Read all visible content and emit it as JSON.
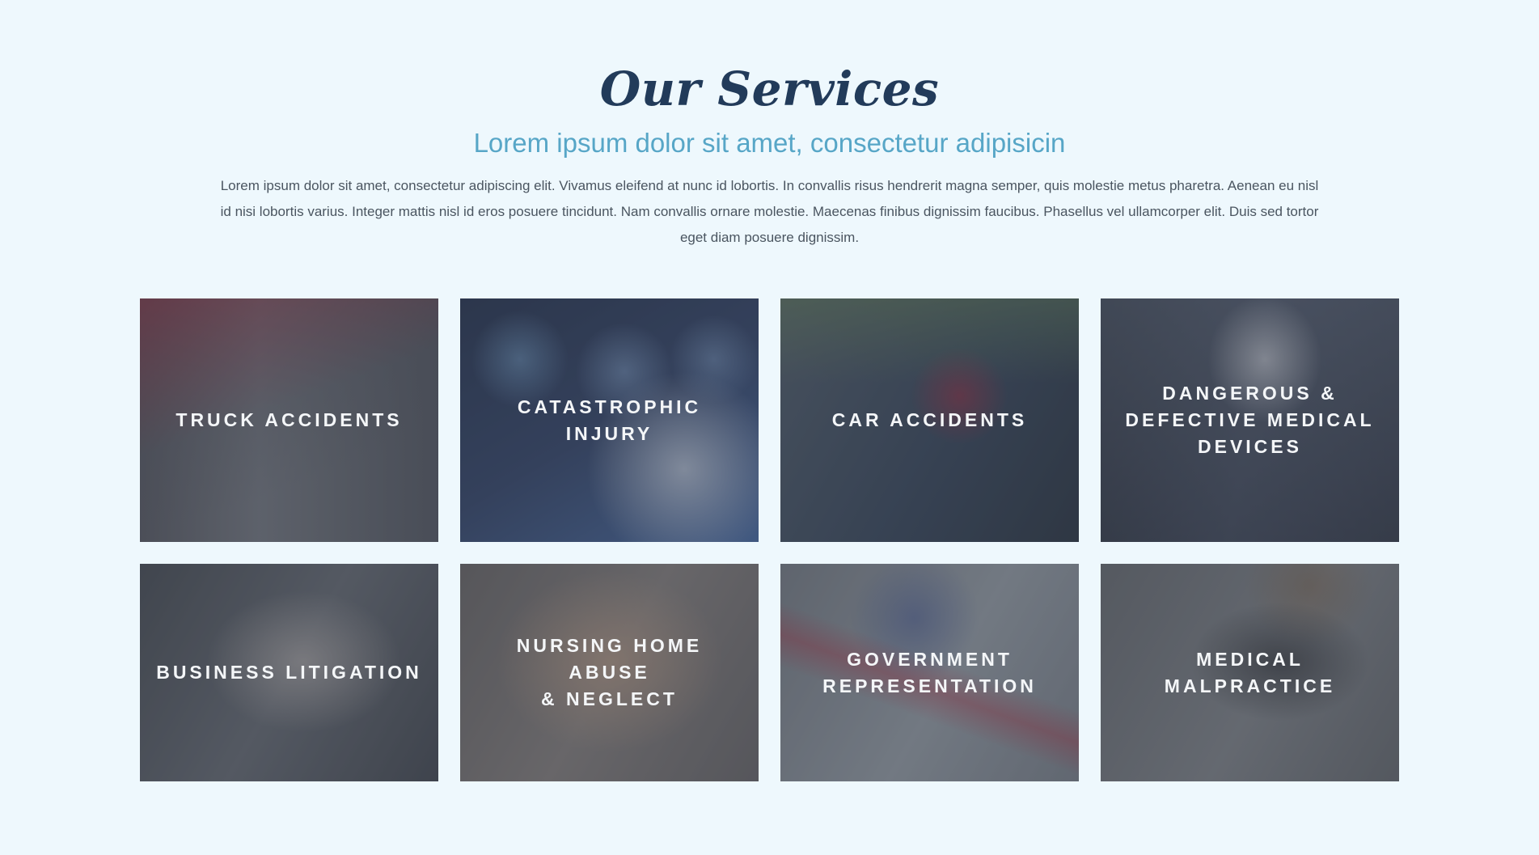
{
  "section": {
    "title": "Our Services",
    "subtitle": "Lorem ipsum dolor sit amet, consectetur adipisicin",
    "description": "Lorem ipsum dolor sit amet, consectetur adipiscing elit. Vivamus eleifend at nunc id lobortis. In convallis risus hendrerit magna semper, quis molestie metus pharetra. Aenean eu nisl id nisi lobortis varius. Integer mattis nisl id eros posuere tincidunt. Nam convallis ornare molestie. Maecenas finibus dignissim faucibus. Phasellus vel ullamcorper elit. Duis sed tortor eget diam posuere dignissim."
  },
  "services": [
    {
      "label": "TRUCK ACCIDENTS"
    },
    {
      "label": "CATASTROPHIC INJURY"
    },
    {
      "label": "CAR ACCIDENTS"
    },
    {
      "label": "DANGEROUS &\nDEFECTIVE MEDICAL\nDEVICES"
    },
    {
      "label": "BUSINESS LITIGATION"
    },
    {
      "label": "NURSING HOME ABUSE\n& NEGLECT"
    },
    {
      "label": "GOVERNMENT\nREPRESENTATION"
    },
    {
      "label": "MEDICAL\nMALPRACTICE"
    }
  ],
  "colors": {
    "page_background": "#eef8fd",
    "title": "#223b5a",
    "subtitle": "#57a6c7",
    "body_text": "#4a5560",
    "card_label": "#f4f6f8"
  }
}
